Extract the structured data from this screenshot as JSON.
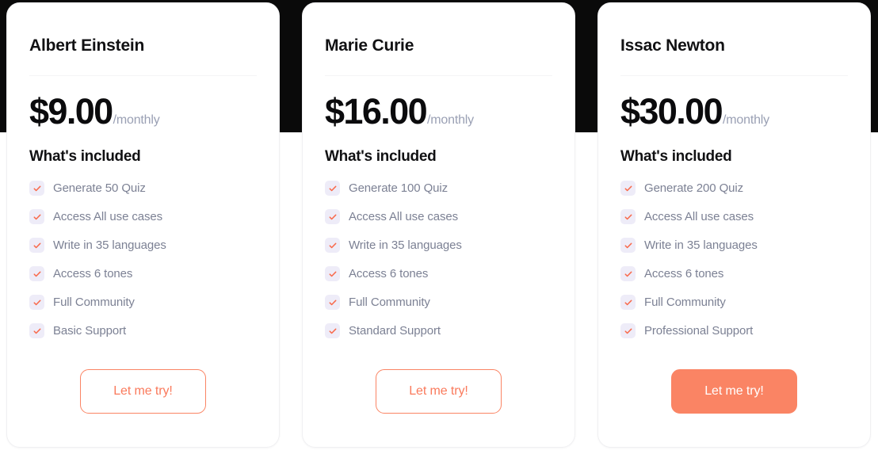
{
  "theme": {
    "accent": "#fa8464",
    "accent_text": "#fa7a5c",
    "check_bg": "#eeecf8",
    "check_mark": "#f9694a",
    "title_color": "#111113",
    "feature_color": "#7c8194",
    "period_color": "#9aa0b4",
    "backdrop_dark": "#0a0a0a",
    "backdrop_light": "#ffffff"
  },
  "plans": [
    {
      "title": "Albert Einstein",
      "price": "$9.00",
      "period": "/monthly",
      "included_heading": "What's included",
      "features": [
        "Generate 50 Quiz",
        "Access All use cases",
        "Write in 35 languages",
        "Access 6 tones",
        "Full Community",
        "Basic Support"
      ],
      "cta_label": "Let me try!",
      "cta_style": "outline"
    },
    {
      "title": "Marie Curie",
      "price": "$16.00",
      "period": "/monthly",
      "included_heading": "What's included",
      "features": [
        "Generate 100 Quiz",
        "Access All use cases",
        "Write in 35 languages",
        "Access 6 tones",
        "Full Community",
        "Standard Support"
      ],
      "cta_label": "Let me try!",
      "cta_style": "outline"
    },
    {
      "title": "Issac Newton",
      "price": "$30.00",
      "period": "/monthly",
      "included_heading": "What's included",
      "features": [
        "Generate 200 Quiz",
        "Access All use cases",
        "Write in 35 languages",
        "Access 6 tones",
        "Full Community",
        "Professional Support"
      ],
      "cta_label": "Let me try!",
      "cta_style": "filled"
    }
  ]
}
